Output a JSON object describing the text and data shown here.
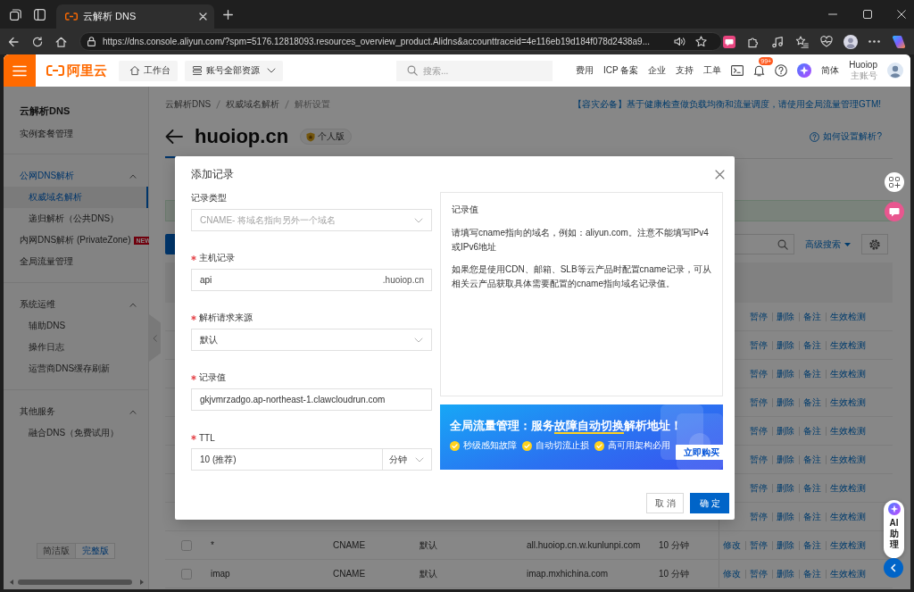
{
  "browser": {
    "tabs": [
      {
        "title": "云解析 DNS",
        "selected": true
      }
    ],
    "url": "https://dns.console.aliyun.com/?spm=5176.12818093.resources_overview_product.Alidns&accounttraceid=4e116eb19d184f078d2438a9..."
  },
  "header": {
    "logo": "阿里云",
    "workbench": "工作台",
    "resources": "账号全部资源",
    "search": {
      "placeholder": "搜索..."
    },
    "links": [
      "费用",
      "ICP 备案",
      "企业",
      "支持",
      "工单"
    ],
    "notifications": "99+",
    "language": "简体",
    "user": {
      "name": "Huoiop",
      "role": "主账号"
    }
  },
  "sidebar": {
    "title": "云解析DNS",
    "sections": [
      {
        "items": [
          {
            "label": "实例套餐管理",
            "selected": false
          }
        ]
      },
      {
        "items": [
          {
            "label": "公网DNS解析",
            "expanded": true,
            "children": [
              {
                "label": "权威域名解析",
                "selected": true
              },
              {
                "label": "递归解析（公共DNS）",
                "selected": false
              }
            ]
          },
          {
            "label": "内网DNS解析 (PrivateZone)",
            "badge": "NEW",
            "selected": false
          },
          {
            "label": "全局流量管理",
            "selected": false
          }
        ]
      },
      {
        "items": [
          {
            "label": "系统运维",
            "expanded": true,
            "children": [
              {
                "label": "辅助DNS",
                "selected": false
              },
              {
                "label": "操作日志",
                "selected": false
              },
              {
                "label": "运营商DNS缓存刷新",
                "selected": false
              }
            ]
          }
        ]
      },
      {
        "items": [
          {
            "label": "其他服务",
            "expanded": true,
            "children": [
              {
                "label": "融合DNS（免费试用）",
                "selected": false
              }
            ]
          }
        ]
      }
    ],
    "versions": [
      {
        "label": "简洁版",
        "selected": false
      },
      {
        "label": "完整版",
        "selected": true
      }
    ]
  },
  "page": {
    "breadcrumb": [
      "云解析DNS",
      "权威域名解析",
      "解析设置"
    ],
    "promo": "【容灾必备】基于健康检查做负载均衡和流量调度，请使用全局流量管理GTM!",
    "domain": "huoiop.cn",
    "edition": "个人版",
    "help_link": "如何设置解析?",
    "advanced_search": "高级搜索"
  },
  "table": {
    "rows": [
      {
        "actions": [
          "暂停",
          "删除",
          "备注",
          "生效检测"
        ]
      },
      {
        "actions": [
          "暂停",
          "删除",
          "备注",
          "生效检测"
        ]
      },
      {
        "actions": [
          "暂停",
          "删除",
          "备注",
          "生效检测"
        ]
      },
      {
        "actions": [
          "暂停",
          "删除",
          "备注",
          "生效检测"
        ]
      },
      {
        "actions": [
          "暂停",
          "删除",
          "备注",
          "生效检测"
        ]
      },
      {
        "actions": [
          "暂停",
          "删除",
          "备注",
          "生效检测"
        ]
      },
      {
        "actions": [
          "暂停",
          "删除",
          "备注",
          "生效检测"
        ]
      },
      {
        "actions": [
          "暂停",
          "删除",
          "备注",
          "生效检测"
        ]
      },
      {
        "checked": false,
        "cells": [
          "*",
          "CNAME",
          "默认",
          "all.huoiop.cn.w.kunlunpi.com",
          "10 分钟"
        ],
        "actions": [
          "修改",
          "暂停",
          "删除",
          "备注",
          "生效检测"
        ]
      },
      {
        "checked": false,
        "cells": [
          "imap",
          "CNAME",
          "默认",
          "imap.mxhichina.com",
          "10 分钟"
        ],
        "actions": [
          "修改",
          "暂停",
          "删除",
          "备注",
          "生效检测"
        ]
      }
    ]
  },
  "modal": {
    "title": "添加记录",
    "fields": [
      {
        "kind": "select",
        "label": "记录类型",
        "required": false,
        "value": "CNAME- 将域名指向另外一个域名",
        "disabled": true
      },
      {
        "kind": "input",
        "label": "主机记录",
        "required": true,
        "value": "api",
        "suffix": ".huoiop.cn"
      },
      {
        "kind": "select",
        "label": "解析请求来源",
        "required": true,
        "value": "默认",
        "disabled": false
      },
      {
        "kind": "input",
        "label": "记录值",
        "required": true,
        "value": "gkjvmrzadgo.ap-northeast-1.clawcloudrun.com"
      },
      {
        "kind": "input_select",
        "label": "TTL",
        "required": true,
        "value": "10 (推荐)",
        "unit": "分钟"
      }
    ],
    "help": {
      "title": "记录值",
      "paragraphs": [
        "请填写cname指向的域名，例如：aliyun.com。注意不能填写IPv4或IPv6地址",
        "如果您是使用CDN、邮箱、SLB等云产品时配置cname记录，可从相关云产品获取具体需要配置的cname指向域名记录值。"
      ]
    },
    "banner": {
      "title": "全局流量管理：服务**故障自动切换**解析地址！",
      "features": [
        "秒级感知故障",
        "自动切流止损",
        "高可用架构必用"
      ],
      "button": "立即购买"
    },
    "buttons": [
      {
        "label": "取消",
        "kind": "secondary"
      },
      {
        "label": "确定",
        "kind": "primary"
      }
    ]
  },
  "assistant": {
    "label": "AI 助理"
  }
}
